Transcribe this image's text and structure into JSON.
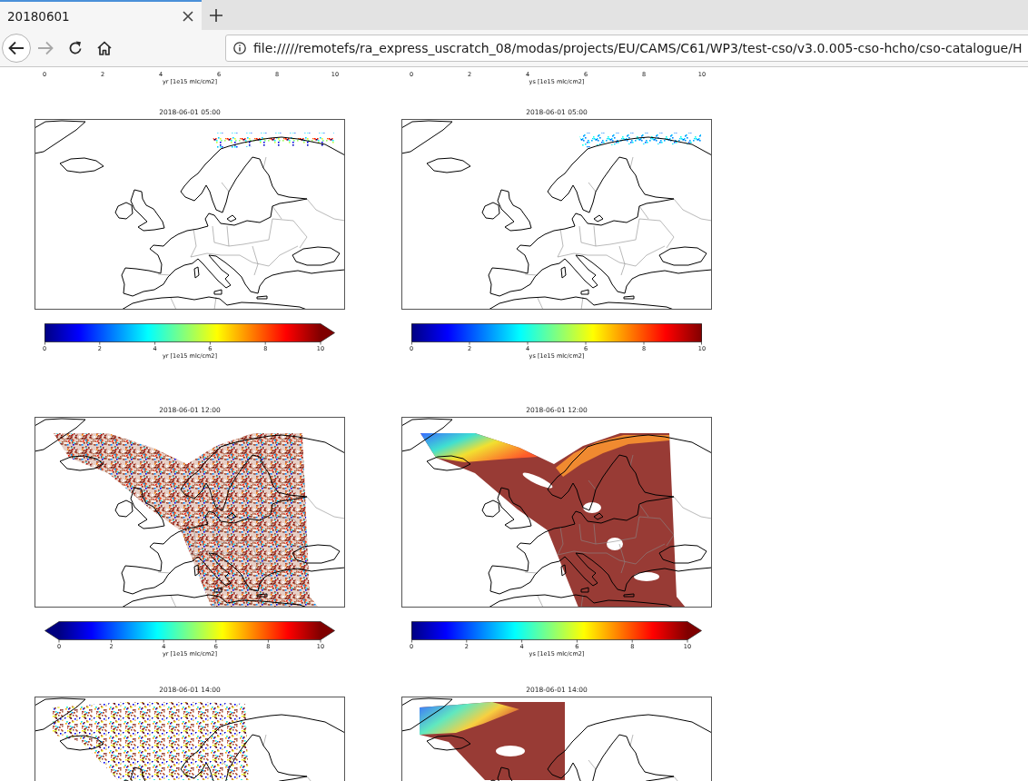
{
  "browser": {
    "tabs": [
      {
        "title": "20180601",
        "selected": true
      }
    ],
    "nav_buttons": [
      {
        "kind": "back",
        "disabled": false
      },
      {
        "kind": "forward",
        "disabled": true
      },
      {
        "kind": "reload",
        "disabled": false
      },
      {
        "kind": "home",
        "disabled": false
      }
    ],
    "url": "file://///remotefs/ra_express_uscratch_08/modas/projects/EU/CAMS/C61/WP3/test-cso/v3.0.005-cso-hcho/cso-catalogue/H"
  },
  "page": {
    "cut_colorbars": [
      {
        "ticks": [
          "0",
          "2",
          "4",
          "6",
          "8",
          "10"
        ],
        "label": "yr [1e15 mlc/cm2]"
      },
      {
        "ticks": [
          "0",
          "2",
          "4",
          "6",
          "8",
          "10"
        ],
        "label": "ys [1e15 mlc/cm2]"
      }
    ],
    "figures": [
      {
        "panels": [
          {
            "title": "2018-06-01 05:00",
            "colorbar": {
              "min_arrow": false,
              "max_arrow": true,
              "ticks": [
                "0",
                "2",
                "4",
                "6",
                "8",
                "10"
              ],
              "label": "yr [1e15 mlc/cm2]"
            }
          },
          {
            "title": "2018-06-01 05:00",
            "colorbar": {
              "min_arrow": false,
              "max_arrow": false,
              "ticks": [
                "0",
                "2",
                "4",
                "6",
                "8",
                "10"
              ],
              "label": "ys [1e15 mlc/cm2]"
            }
          }
        ]
      },
      {
        "panels": [
          {
            "title": "2018-06-01 12:00",
            "colorbar": {
              "min_arrow": true,
              "max_arrow": true,
              "ticks": [
                "0",
                "2",
                "4",
                "6",
                "8",
                "10"
              ],
              "label": "yr [1e15 mlc/cm2]"
            }
          },
          {
            "title": "2018-06-01 12:00",
            "colorbar": {
              "min_arrow": false,
              "max_arrow": true,
              "ticks": [
                "0",
                "2",
                "4",
                "6",
                "8",
                "10"
              ],
              "label": "ys [1e15 mlc/cm2]"
            }
          }
        ]
      },
      {
        "panels": [
          {
            "title": "2018-06-01 14:00"
          },
          {
            "title": "2018-06-01 14:00"
          }
        ]
      }
    ]
  }
}
